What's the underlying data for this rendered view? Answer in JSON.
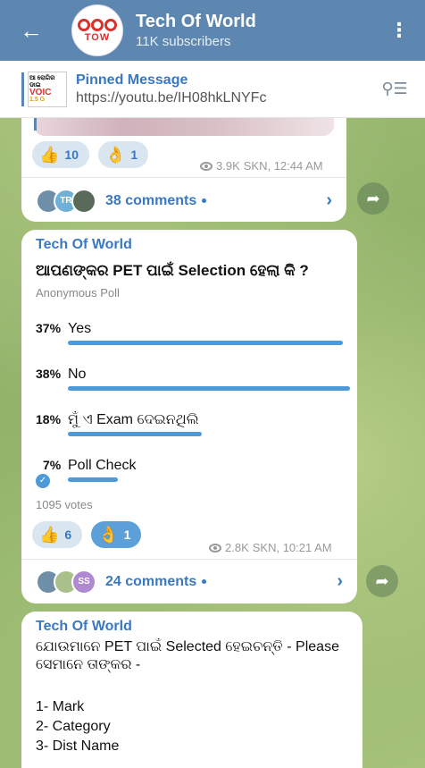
{
  "header": {
    "back_icon": "arrow-left-icon",
    "avatar_text": "TOW",
    "title": "Tech Of World",
    "subtitle": "11K subscribers",
    "menu_icon": "more-vertical-icon"
  },
  "pinned": {
    "title": "Pinned Message",
    "link": "https://youtu.be/IH08hkLNYFc",
    "thumb_line1": "ଆ ରୋଗିର ଡାଇ",
    "thumb_line2": "VOIC",
    "thumb_line3": "1.5 G",
    "unpin_icon": "unpin-list-icon"
  },
  "post1": {
    "reactions": [
      {
        "emoji": "👍",
        "count": "10"
      },
      {
        "emoji": "👌",
        "count": "1"
      }
    ],
    "views": "3.9K",
    "signature_time": "SKN, 12:44 AM",
    "avatars": [
      "",
      "TR",
      ""
    ],
    "comments": "38 comments"
  },
  "poll": {
    "author": "Tech Of World",
    "question": "ଆପଣଙ୍କର PET ପାଇଁ Selection ହେଲା କି ?",
    "type": "Anonymous Poll",
    "options": [
      {
        "pct": "37%",
        "label": "Yes",
        "fraction": 0.37,
        "chosen": false
      },
      {
        "pct": "38%",
        "label": "No",
        "fraction": 0.38,
        "chosen": false
      },
      {
        "pct": "18%",
        "label": "ମୁଁ ଏ Exam ଦେଇନଥିଲି",
        "fraction": 0.18,
        "chosen": false
      },
      {
        "pct": "7%",
        "label": "Poll Check",
        "fraction": 0.07,
        "chosen": true
      }
    ],
    "votes": "1095 votes",
    "reactions": [
      {
        "emoji": "👍",
        "count": "6"
      },
      {
        "emoji": "👌",
        "count": "1"
      }
    ],
    "views": "2.8K",
    "signature_time": "SKN, 10:21 AM",
    "avatars": [
      "",
      "",
      "SS"
    ],
    "comments": "24 comments"
  },
  "post3": {
    "author": "Tech Of World",
    "body": "ଯୋଉମାନେ PET ପାଇଁ Selected ହେଇଚନ୍ତି - Please ସେମାନେ ତାଙ୍କର -",
    "list": [
      "1- Mark",
      "2- Category",
      "3- Dist Name"
    ]
  },
  "colors": {
    "header": "#5d87b0",
    "accent": "#3a78c2",
    "poll_bar": "#4e9ad8"
  }
}
